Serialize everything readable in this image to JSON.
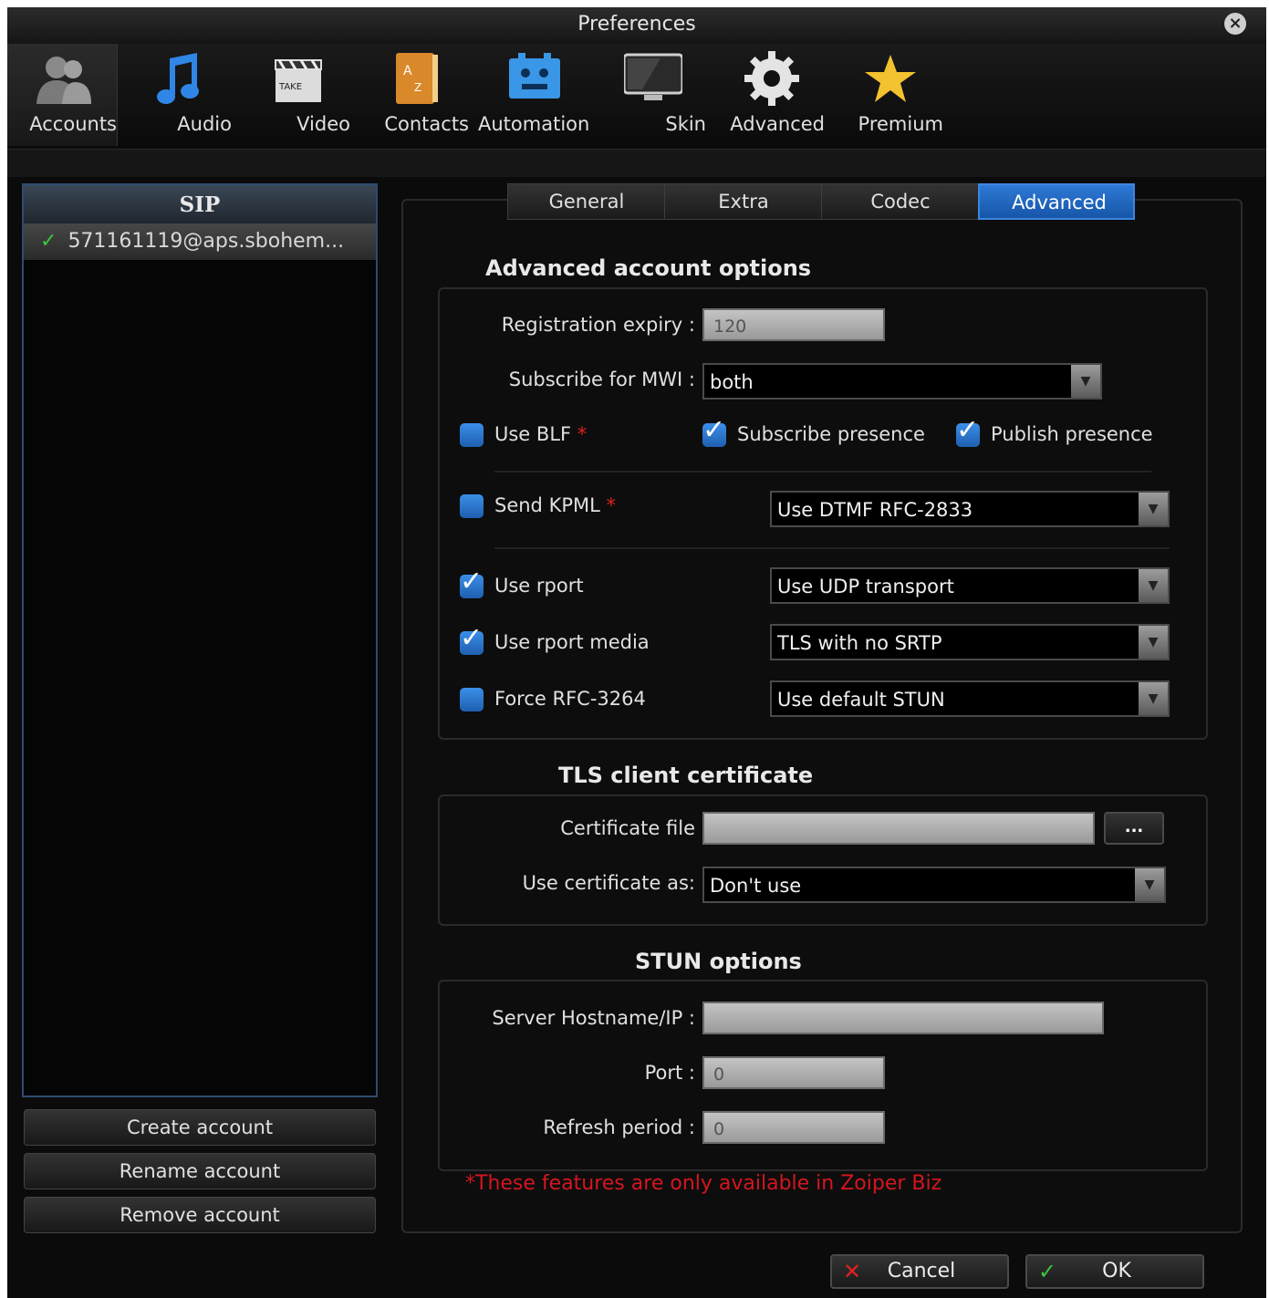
{
  "window": {
    "title": "Preferences"
  },
  "toolbar": {
    "items": [
      {
        "label": "Accounts",
        "icon": "users-icon"
      },
      {
        "label": "Audio",
        "icon": "music-note-icon"
      },
      {
        "label": "Video",
        "icon": "clapperboard-icon"
      },
      {
        "label": "Contacts",
        "icon": "address-book-icon"
      },
      {
        "label": "Automation",
        "icon": "robot-icon"
      },
      {
        "label": "Skin",
        "icon": "monitor-icon"
      },
      {
        "label": "Advanced",
        "icon": "gear-icon"
      },
      {
        "label": "Premium",
        "icon": "star-icon"
      }
    ]
  },
  "accounts": {
    "header": "SIP",
    "items": [
      {
        "label": "571161119@aps.sbohem...",
        "status": "checkmark-icon"
      }
    ],
    "buttons": {
      "create": "Create account",
      "rename": "Rename account",
      "remove": "Remove account"
    }
  },
  "tabs": [
    "General",
    "Extra",
    "Codec",
    "Advanced"
  ],
  "advanced": {
    "title": "Advanced account options",
    "registration_expiry_label": "Registration expiry :",
    "registration_expiry_value": "120",
    "mwi_label": "Subscribe for MWI :",
    "mwi_value": "both",
    "use_blf": "Use BLF",
    "subscribe_presence": "Subscribe presence",
    "publish_presence": "Publish presence",
    "send_kpml": "Send KPML",
    "dtmf_value": "Use DTMF RFC-2833",
    "use_rport": "Use rport",
    "transport_value": "Use UDP transport",
    "use_rport_media": "Use rport media",
    "srtp_value": "TLS with no SRTP",
    "force_rfc": "Force RFC-3264",
    "stun_value": "Use default STUN",
    "star": "*"
  },
  "tls": {
    "title": "TLS client certificate",
    "cert_file_label": "Certificate file",
    "browse": "...",
    "use_as_label": "Use certificate as:",
    "use_as_value": "Don't use"
  },
  "stun": {
    "title": "STUN options",
    "server_label": "Server Hostname/IP :",
    "port_label": "Port :",
    "port_value": "0",
    "refresh_label": "Refresh period :",
    "refresh_value": "0"
  },
  "note": "*These features are only available in Zoiper Biz",
  "footer": {
    "cancel": "Cancel",
    "ok": "OK"
  },
  "colors": {
    "accent": "#1e6fd0",
    "warning": "#d4161e",
    "ok_check": "#3cc43c"
  }
}
